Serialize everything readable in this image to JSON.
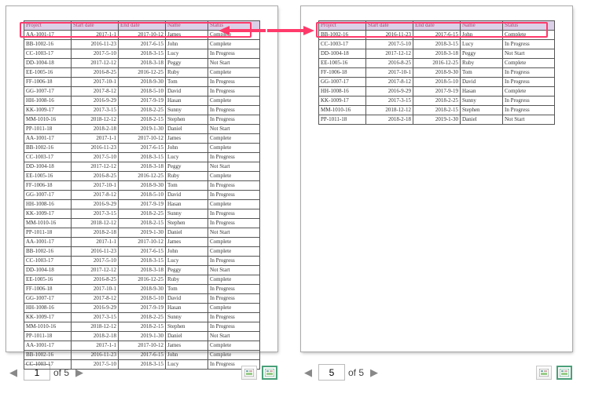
{
  "chart_data": {
    "type": "table",
    "columns": [
      "Project",
      "Start date",
      "End date",
      "Name",
      "Status"
    ],
    "pages": {
      "left": {
        "page_number": "1",
        "rows": [
          [
            "AA-1001-17",
            "2017-1-1",
            "2017-10-12",
            "James",
            "Complete"
          ],
          [
            "BB-1002-16",
            "2016-11-23",
            "2017-6-15",
            "John",
            "Complete"
          ],
          [
            "CC-1003-17",
            "2017-5-10",
            "2018-3-15",
            "Lucy",
            "In Progress"
          ],
          [
            "DD-1004-18",
            "2017-12-12",
            "2018-3-18",
            "Peggy",
            "Not Start"
          ],
          [
            "EE-1005-16",
            "2016-8-25",
            "2016-12-25",
            "Ruby",
            "Complete"
          ],
          [
            "FF-1006-18",
            "2017-10-1",
            "2018-9-30",
            "Tom",
            "In Progress"
          ],
          [
            "GG-1007-17",
            "2017-8-12",
            "2018-5-10",
            "David",
            "In Progress"
          ],
          [
            "HH-1008-16",
            "2016-9-29",
            "2017-9-19",
            "Hasan",
            "Complete"
          ],
          [
            "KK-1009-17",
            "2017-3-15",
            "2018-2-25",
            "Sunny",
            "In Progress"
          ],
          [
            "MM-1010-16",
            "2018-12-12",
            "2018-2-15",
            "Stephen",
            "In Progress"
          ],
          [
            "PP-1011-18",
            "2018-2-18",
            "2019-1-30",
            "Daniel",
            "Not Start"
          ],
          [
            "AA-1001-17",
            "2017-1-1",
            "2017-10-12",
            "James",
            "Complete"
          ],
          [
            "BB-1002-16",
            "2016-11-23",
            "2017-6-15",
            "John",
            "Complete"
          ],
          [
            "CC-1003-17",
            "2017-5-10",
            "2018-3-15",
            "Lucy",
            "In Progress"
          ],
          [
            "DD-1004-18",
            "2017-12-12",
            "2018-3-18",
            "Peggy",
            "Not Start"
          ],
          [
            "EE-1005-16",
            "2016-8-25",
            "2016-12-25",
            "Ruby",
            "Complete"
          ],
          [
            "FF-1006-18",
            "2017-10-1",
            "2018-9-30",
            "Tom",
            "In Progress"
          ],
          [
            "GG-1007-17",
            "2017-8-12",
            "2018-5-10",
            "David",
            "In Progress"
          ],
          [
            "HH-1008-16",
            "2016-9-29",
            "2017-9-19",
            "Hasan",
            "Complete"
          ],
          [
            "KK-1009-17",
            "2017-3-15",
            "2018-2-25",
            "Sunny",
            "In Progress"
          ],
          [
            "MM-1010-16",
            "2018-12-12",
            "2018-2-15",
            "Stephen",
            "In Progress"
          ],
          [
            "PP-1011-18",
            "2018-2-18",
            "2019-1-30",
            "Daniel",
            "Not Start"
          ],
          [
            "AA-1001-17",
            "2017-1-1",
            "2017-10-12",
            "James",
            "Complete"
          ],
          [
            "BB-1002-16",
            "2016-11-23",
            "2017-6-15",
            "John",
            "Complete"
          ],
          [
            "CC-1003-17",
            "2017-5-10",
            "2018-3-15",
            "Lucy",
            "In Progress"
          ],
          [
            "DD-1004-18",
            "2017-12-12",
            "2018-3-18",
            "Peggy",
            "Not Start"
          ],
          [
            "EE-1005-16",
            "2016-8-25",
            "2016-12-25",
            "Ruby",
            "Complete"
          ],
          [
            "FF-1006-18",
            "2017-10-1",
            "2018-9-30",
            "Tom",
            "In Progress"
          ],
          [
            "GG-1007-17",
            "2017-8-12",
            "2018-5-10",
            "David",
            "In Progress"
          ],
          [
            "HH-1008-16",
            "2016-9-29",
            "2017-9-19",
            "Hasan",
            "Complete"
          ],
          [
            "KK-1009-17",
            "2017-3-15",
            "2018-2-25",
            "Sunny",
            "In Progress"
          ],
          [
            "MM-1010-16",
            "2018-12-12",
            "2018-2-15",
            "Stephen",
            "In Progress"
          ],
          [
            "PP-1011-18",
            "2018-2-18",
            "2019-1-30",
            "Daniel",
            "Not Start"
          ],
          [
            "AA-1001-17",
            "2017-1-1",
            "2017-10-12",
            "James",
            "Complete"
          ],
          [
            "BB-1002-16",
            "2016-11-23",
            "2017-6-15",
            "John",
            "Complete"
          ],
          [
            "CC-1003-17",
            "2017-5-10",
            "2018-3-15",
            "Lucy",
            "In Progress"
          ]
        ]
      },
      "right": {
        "page_number": "5",
        "rows": [
          [
            "BB-1002-16",
            "2016-11-23",
            "2017-6-15",
            "John",
            "Complete"
          ],
          [
            "CC-1003-17",
            "2017-5-10",
            "2018-3-15",
            "Lucy",
            "In Progress"
          ],
          [
            "DD-1004-18",
            "2017-12-12",
            "2018-3-18",
            "Peggy",
            "Not Start"
          ],
          [
            "EE-1005-16",
            "2016-8-25",
            "2016-12-25",
            "Ruby",
            "Complete"
          ],
          [
            "FF-1006-18",
            "2017-10-1",
            "2018-9-30",
            "Tom",
            "In Progress"
          ],
          [
            "GG-1007-17",
            "2017-8-12",
            "2018-5-10",
            "David",
            "In Progress"
          ],
          [
            "HH-1008-16",
            "2016-9-29",
            "2017-9-19",
            "Hasan",
            "Complete"
          ],
          [
            "KK-1009-17",
            "2017-3-15",
            "2018-2-25",
            "Sunny",
            "In Progress"
          ],
          [
            "MM-1010-16",
            "2018-12-12",
            "2018-2-15",
            "Stephen",
            "In Progress"
          ],
          [
            "PP-1011-18",
            "2018-2-18",
            "2019-1-30",
            "Daniel",
            "Not Start"
          ]
        ]
      }
    }
  },
  "pager": {
    "of_label": "of 5",
    "prev_glyph": "◀",
    "next_glyph": "▶"
  },
  "colors": {
    "annotation": "#ff3a6b",
    "header_bg": "#dcd0e8",
    "header_text": "#b04070"
  }
}
